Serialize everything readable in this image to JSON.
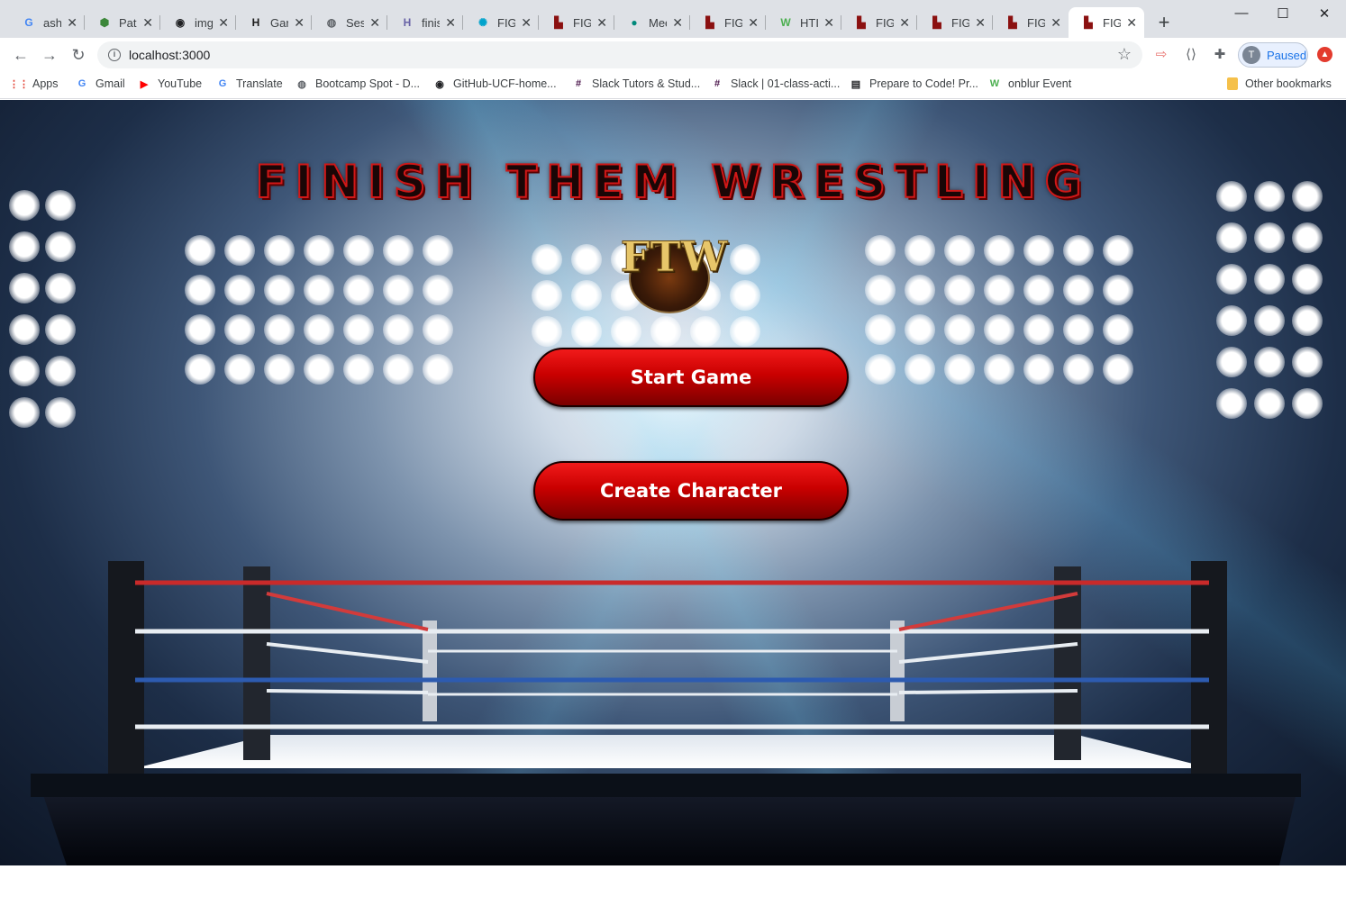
{
  "browser": {
    "tabs": [
      {
        "title": "ash",
        "icon": "google-icon",
        "color": "#4285f4",
        "glyph": "G"
      },
      {
        "title": "Path",
        "icon": "node-icon",
        "color": "#3c873a",
        "glyph": "⬢"
      },
      {
        "title": "img",
        "icon": "github-icon",
        "color": "#202124",
        "glyph": "◉"
      },
      {
        "title": "Gar",
        "icon": "hn-icon",
        "color": "#1a1a1a",
        "glyph": "H"
      },
      {
        "title": "Ses",
        "icon": "globe-icon",
        "color": "#5f6368",
        "glyph": "◍"
      },
      {
        "title": "finis",
        "icon": "heroku-icon",
        "color": "#6762a6",
        "glyph": "H"
      },
      {
        "title": "FIGI",
        "icon": "react-icon",
        "color": "#00a3cc",
        "glyph": "✺"
      },
      {
        "title": "FIGI",
        "icon": "ftw-tab-icon",
        "color": "#8b1010",
        "glyph": "▙"
      },
      {
        "title": "Mee",
        "icon": "meet-icon",
        "color": "#00897b",
        "glyph": "●"
      },
      {
        "title": "FIGI",
        "icon": "ftw-tab-icon",
        "color": "#8b1010",
        "glyph": "▙"
      },
      {
        "title": "HTI",
        "icon": "html-icon",
        "color": "#4caf50",
        "glyph": "W"
      },
      {
        "title": "FIGI",
        "icon": "ftw-tab-icon",
        "color": "#8b1010",
        "glyph": "▙"
      },
      {
        "title": "FIGI",
        "icon": "ftw-tab-icon",
        "color": "#8b1010",
        "glyph": "▙"
      },
      {
        "title": "FIGI",
        "icon": "ftw-tab-icon",
        "color": "#8b1010",
        "glyph": "▙"
      },
      {
        "title": "FIGI",
        "icon": "ftw-tab-icon",
        "color": "#8b1010",
        "glyph": "▙"
      }
    ],
    "active_tab_index": 14,
    "url": "localhost:3000",
    "profile_initial": "T",
    "profile_status": "Paused",
    "bookmarks": [
      {
        "label": "Apps",
        "icon": "apps-grid-icon",
        "color": "#e34133",
        "glyph": "⋮⋮"
      },
      {
        "label": "Gmail",
        "icon": "google-icon",
        "color": "#4285f4",
        "glyph": "G"
      },
      {
        "label": "YouTube",
        "icon": "youtube-icon",
        "color": "#ff0000",
        "glyph": "▶"
      },
      {
        "label": "Translate",
        "icon": "translate-icon",
        "color": "#4285f4",
        "glyph": "G"
      },
      {
        "label": "Bootcamp Spot - D...",
        "icon": "globe-icon",
        "color": "#5f6368",
        "glyph": "◍"
      },
      {
        "label": "GitHub-UCF-home...",
        "icon": "github-icon",
        "color": "#202124",
        "glyph": "◉"
      },
      {
        "label": "Slack Tutors & Stud...",
        "icon": "slack-icon",
        "color": "#4a154b",
        "glyph": "#"
      },
      {
        "label": "Slack | 01-class-acti...",
        "icon": "slack-icon",
        "color": "#4a154b",
        "glyph": "#"
      },
      {
        "label": "Prepare to Code! Pr...",
        "icon": "book-icon",
        "color": "#202124",
        "glyph": "▤"
      },
      {
        "label": "onblur Event",
        "icon": "w3schools-icon",
        "color": "#4caf50",
        "glyph": "W"
      }
    ],
    "other_bookmarks": "Other bookmarks"
  },
  "page": {
    "title": "FINISH THEM WRESTLING",
    "logo_text": "FTW",
    "buttons": {
      "start": "Start Game",
      "create": "Create Character"
    }
  },
  "colors": {
    "button_red": "#d30000",
    "title_outline": "#d01818",
    "logo_gold": "#e7c66a"
  }
}
